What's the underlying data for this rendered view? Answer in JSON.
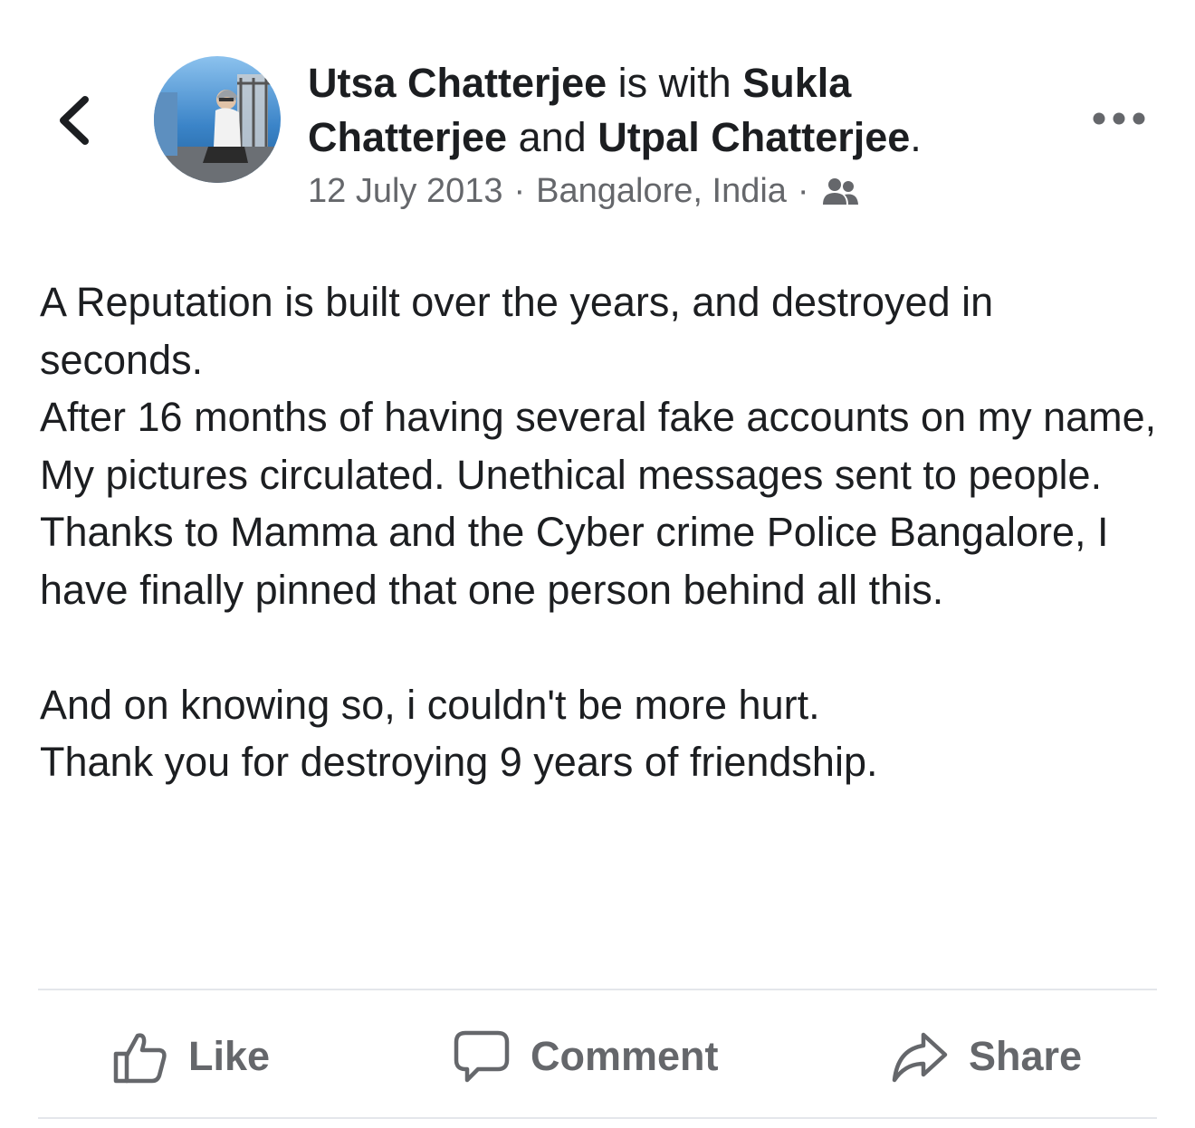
{
  "header": {
    "author": "Utsa Chatterjee",
    "with_text": "is with",
    "tagged_1": "Sukla Chatterjee",
    "and_text": "and",
    "tagged_2": "Utpal Chatterjee",
    "period": ".",
    "date": "12 July 2013",
    "separator": "·",
    "location": "Bangalore, India",
    "audience_icon": "friends-icon"
  },
  "post": {
    "lines": [
      "A Reputation is built over the years, and destroyed in seconds.",
      "After 16 months of having several fake accounts on my name,",
      "My pictures circulated. Unethical messages sent to people.",
      "Thanks to Mamma and the Cyber crime Police Bangalore, I have finally pinned that one person behind all this.",
      "",
      "And on knowing so, i couldn't be more hurt.",
      "Thank you for destroying 9 years of friendship."
    ]
  },
  "actions": {
    "like": "Like",
    "comment": "Comment",
    "share": "Share"
  },
  "colors": {
    "text": "#1c1e21",
    "secondary": "#65676b",
    "divider": "#e4e6eb"
  }
}
